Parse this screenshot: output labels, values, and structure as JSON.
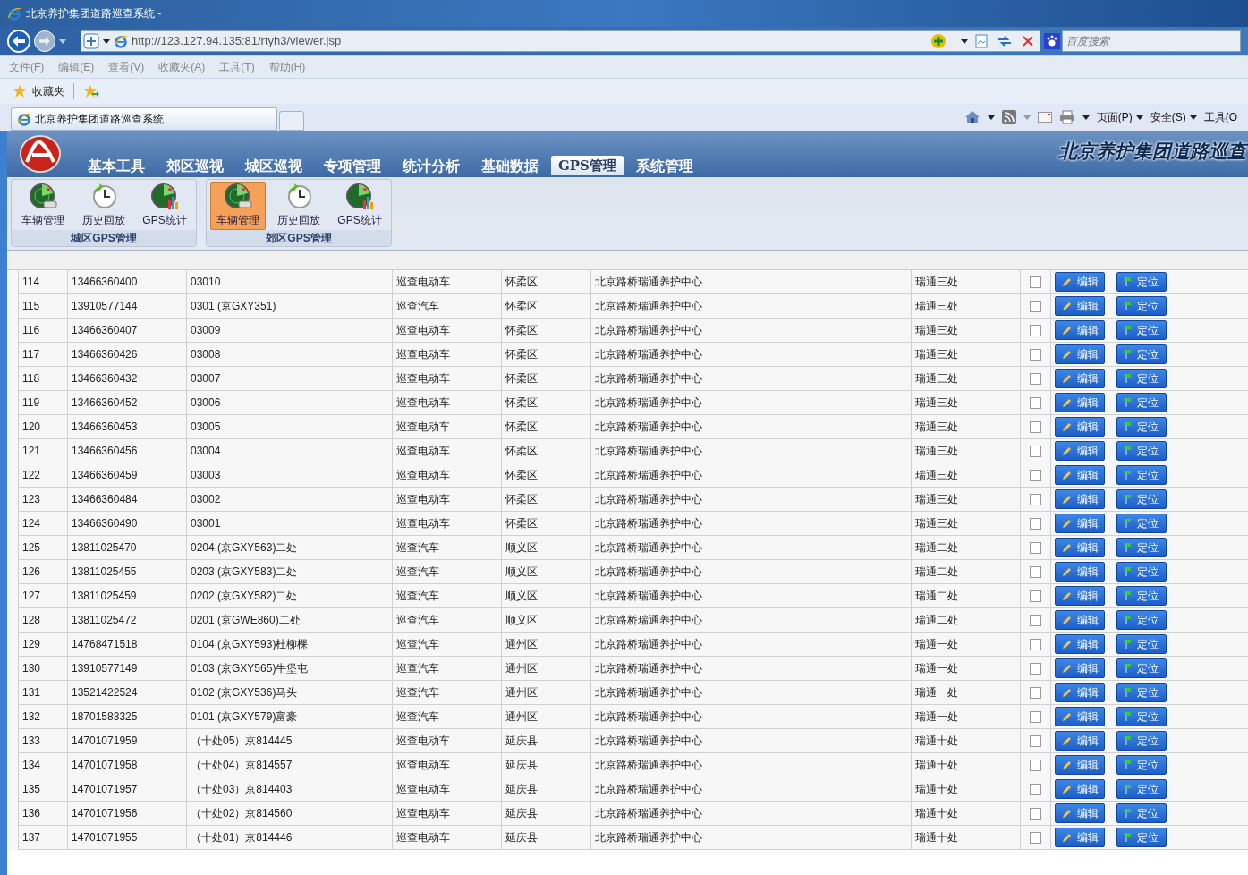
{
  "window": {
    "title": "北京养护集团道路巡查系统 -"
  },
  "address_bar": {
    "url": "http://123.127.94.135:81/rtyh3/viewer.jsp"
  },
  "search": {
    "placeholder": "百度搜索"
  },
  "menu": [
    "文件(F)",
    "编辑(E)",
    "查看(V)",
    "收藏夹(A)",
    "工具(T)",
    "帮助(H)"
  ],
  "favorites": {
    "label": "收藏夹"
  },
  "browser_tab": {
    "label": "北京养护集团道路巡查系统"
  },
  "command_bar": [
    "页面(P)",
    "安全(S)",
    "工具(O"
  ],
  "app": {
    "banner": "北京养护集团道路巡查",
    "nav": [
      {
        "label": "基本工具",
        "selected": false
      },
      {
        "label": "郊区巡视",
        "selected": false
      },
      {
        "label": "城区巡视",
        "selected": false
      },
      {
        "label": "专项管理",
        "selected": false
      },
      {
        "label": "统计分析",
        "selected": false
      },
      {
        "label": "基础数据",
        "selected": false
      },
      {
        "label": "GPS管理",
        "selected": true
      },
      {
        "label": "系统管理",
        "selected": false
      }
    ],
    "ribbon": [
      {
        "title": "城区GPS管理",
        "buttons": [
          {
            "label": "车辆管理",
            "kind": "radar",
            "selected": false
          },
          {
            "label": "历史回放",
            "kind": "clock",
            "selected": false
          },
          {
            "label": "GPS统计",
            "kind": "chart",
            "selected": false
          }
        ]
      },
      {
        "title": "郊区GPS管理",
        "buttons": [
          {
            "label": "车辆管理",
            "kind": "radar",
            "selected": true
          },
          {
            "label": "历史回放",
            "kind": "clock",
            "selected": false
          },
          {
            "label": "GPS统计",
            "kind": "chart",
            "selected": false
          }
        ]
      }
    ]
  },
  "table": {
    "rows": [
      {
        "no": "114",
        "phone": "13466360400",
        "name": "03010",
        "type": "巡查电动车",
        "district": "怀柔区",
        "org": "北京路桥瑞通养护中心",
        "unit": "瑞通三处",
        "checked": false,
        "edit": "编辑",
        "locate": "定位"
      },
      {
        "no": "115",
        "phone": "13910577144",
        "name": "0301 (京GXY351)",
        "type": "巡查汽车",
        "district": "怀柔区",
        "org": "北京路桥瑞通养护中心",
        "unit": "瑞通三处",
        "checked": false,
        "edit": "编辑",
        "locate": "定位"
      },
      {
        "no": "116",
        "phone": "13466360407",
        "name": "03009",
        "type": "巡查电动车",
        "district": "怀柔区",
        "org": "北京路桥瑞通养护中心",
        "unit": "瑞通三处",
        "checked": false,
        "edit": "编辑",
        "locate": "定位"
      },
      {
        "no": "117",
        "phone": "13466360426",
        "name": "03008",
        "type": "巡查电动车",
        "district": "怀柔区",
        "org": "北京路桥瑞通养护中心",
        "unit": "瑞通三处",
        "checked": false,
        "edit": "编辑",
        "locate": "定位"
      },
      {
        "no": "118",
        "phone": "13466360432",
        "name": "03007",
        "type": "巡查电动车",
        "district": "怀柔区",
        "org": "北京路桥瑞通养护中心",
        "unit": "瑞通三处",
        "checked": false,
        "edit": "编辑",
        "locate": "定位"
      },
      {
        "no": "119",
        "phone": "13466360452",
        "name": "03006",
        "type": "巡查电动车",
        "district": "怀柔区",
        "org": "北京路桥瑞通养护中心",
        "unit": "瑞通三处",
        "checked": false,
        "edit": "编辑",
        "locate": "定位"
      },
      {
        "no": "120",
        "phone": "13466360453",
        "name": "03005",
        "type": "巡查电动车",
        "district": "怀柔区",
        "org": "北京路桥瑞通养护中心",
        "unit": "瑞通三处",
        "checked": false,
        "edit": "编辑",
        "locate": "定位"
      },
      {
        "no": "121",
        "phone": "13466360456",
        "name": "03004",
        "type": "巡查电动车",
        "district": "怀柔区",
        "org": "北京路桥瑞通养护中心",
        "unit": "瑞通三处",
        "checked": false,
        "edit": "编辑",
        "locate": "定位"
      },
      {
        "no": "122",
        "phone": "13466360459",
        "name": "03003",
        "type": "巡查电动车",
        "district": "怀柔区",
        "org": "北京路桥瑞通养护中心",
        "unit": "瑞通三处",
        "checked": false,
        "edit": "编辑",
        "locate": "定位"
      },
      {
        "no": "123",
        "phone": "13466360484",
        "name": "03002",
        "type": "巡查电动车",
        "district": "怀柔区",
        "org": "北京路桥瑞通养护中心",
        "unit": "瑞通三处",
        "checked": false,
        "edit": "编辑",
        "locate": "定位"
      },
      {
        "no": "124",
        "phone": "13466360490",
        "name": "03001",
        "type": "巡查电动车",
        "district": "怀柔区",
        "org": "北京路桥瑞通养护中心",
        "unit": "瑞通三处",
        "checked": false,
        "edit": "编辑",
        "locate": "定位"
      },
      {
        "no": "125",
        "phone": "13811025470",
        "name": "0204 (京GXY563)二处",
        "type": "巡查汽车",
        "district": "顺义区",
        "org": "北京路桥瑞通养护中心",
        "unit": "瑞通二处",
        "checked": false,
        "edit": "编辑",
        "locate": "定位"
      },
      {
        "no": "126",
        "phone": "13811025455",
        "name": "0203 (京GXY583)二处",
        "type": "巡查汽车",
        "district": "顺义区",
        "org": "北京路桥瑞通养护中心",
        "unit": "瑞通二处",
        "checked": false,
        "edit": "编辑",
        "locate": "定位"
      },
      {
        "no": "127",
        "phone": "13811025459",
        "name": "0202 (京GXY582)二处",
        "type": "巡查汽车",
        "district": "顺义区",
        "org": "北京路桥瑞通养护中心",
        "unit": "瑞通二处",
        "checked": false,
        "edit": "编辑",
        "locate": "定位"
      },
      {
        "no": "128",
        "phone": "13811025472",
        "name": "0201 (京GWE860)二处",
        "type": "巡查汽车",
        "district": "顺义区",
        "org": "北京路桥瑞通养护中心",
        "unit": "瑞通二处",
        "checked": false,
        "edit": "编辑",
        "locate": "定位"
      },
      {
        "no": "129",
        "phone": "14768471518",
        "name": "0104 (京GXY593)杜柳棵",
        "type": "巡查汽车",
        "district": "通州区",
        "org": "北京路桥瑞通养护中心",
        "unit": "瑞通一处",
        "checked": false,
        "edit": "编辑",
        "locate": "定位"
      },
      {
        "no": "130",
        "phone": "13910577149",
        "name": "0103 (京GXY565)牛堡屯",
        "type": "巡查汽车",
        "district": "通州区",
        "org": "北京路桥瑞通养护中心",
        "unit": "瑞通一处",
        "checked": false,
        "edit": "编辑",
        "locate": "定位"
      },
      {
        "no": "131",
        "phone": "13521422524",
        "name": "0102 (京GXY536)马头",
        "type": "巡查汽车",
        "district": "通州区",
        "org": "北京路桥瑞通养护中心",
        "unit": "瑞通一处",
        "checked": false,
        "edit": "编辑",
        "locate": "定位"
      },
      {
        "no": "132",
        "phone": "18701583325",
        "name": "0101 (京GXY579)富豪",
        "type": "巡查汽车",
        "district": "通州区",
        "org": "北京路桥瑞通养护中心",
        "unit": "瑞通一处",
        "checked": false,
        "edit": "编辑",
        "locate": "定位"
      },
      {
        "no": "133",
        "phone": "14701071959",
        "name": "（十处05）京814445",
        "type": "巡查电动车",
        "district": "延庆县",
        "org": "北京路桥瑞通养护中心",
        "unit": "瑞通十处",
        "checked": false,
        "edit": "编辑",
        "locate": "定位"
      },
      {
        "no": "134",
        "phone": "14701071958",
        "name": "（十处04）京814557",
        "type": "巡查电动车",
        "district": "延庆县",
        "org": "北京路桥瑞通养护中心",
        "unit": "瑞通十处",
        "checked": false,
        "edit": "编辑",
        "locate": "定位"
      },
      {
        "no": "135",
        "phone": "14701071957",
        "name": "（十处03）京814403",
        "type": "巡查电动车",
        "district": "延庆县",
        "org": "北京路桥瑞通养护中心",
        "unit": "瑞通十处",
        "checked": false,
        "edit": "编辑",
        "locate": "定位"
      },
      {
        "no": "136",
        "phone": "14701071956",
        "name": "（十处02）京814560",
        "type": "巡查电动车",
        "district": "延庆县",
        "org": "北京路桥瑞通养护中心",
        "unit": "瑞通十处",
        "checked": false,
        "edit": "编辑",
        "locate": "定位"
      },
      {
        "no": "137",
        "phone": "14701071955",
        "name": "（十处01）京814446",
        "type": "巡查电动车",
        "district": "延庆县",
        "org": "北京路桥瑞通养护中心",
        "unit": "瑞通十处",
        "checked": false,
        "edit": "编辑",
        "locate": "定位"
      }
    ]
  }
}
